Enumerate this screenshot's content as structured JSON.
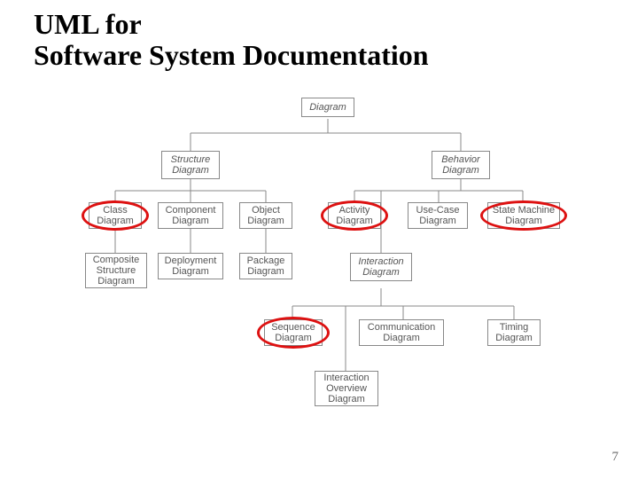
{
  "title_line1": "UML for",
  "title_line2": "Software System Documentation",
  "page_number": "7",
  "nodes": {
    "root": {
      "label": "Diagram"
    },
    "structure": {
      "label": "Structure\nDiagram"
    },
    "behavior": {
      "label": "Behavior\nDiagram"
    },
    "class": {
      "label": "Class\nDiagram"
    },
    "component": {
      "label": "Component\nDiagram"
    },
    "object": {
      "label": "Object\nDiagram"
    },
    "activity": {
      "label": "Activity\nDiagram"
    },
    "usecase": {
      "label": "Use-Case\nDiagram"
    },
    "statemachine": {
      "label": "State Machine\nDiagram"
    },
    "composite": {
      "label": "Composite\nStructure\nDiagram"
    },
    "deployment": {
      "label": "Deployment\nDiagram"
    },
    "package": {
      "label": "Package\nDiagram"
    },
    "interaction": {
      "label": "Interaction\nDiagram"
    },
    "sequence": {
      "label": "Sequence\nDiagram"
    },
    "communication": {
      "label": "Communication\nDiagram"
    },
    "timing": {
      "label": "Timing\nDiagram"
    },
    "ioverview": {
      "label": "Interaction\nOverview\nDiagram"
    }
  },
  "highlighted": [
    "class",
    "activity",
    "statemachine",
    "sequence"
  ],
  "hierarchy": {
    "Diagram": {
      "Structure Diagram": [
        "Class Diagram",
        "Component Diagram",
        "Object Diagram",
        "Composite Structure Diagram",
        "Deployment Diagram",
        "Package Diagram"
      ],
      "Behavior Diagram": {
        "Activity Diagram": [],
        "Use-Case Diagram": [],
        "State Machine Diagram": [],
        "Interaction Diagram": [
          "Sequence Diagram",
          "Communication Diagram",
          "Timing Diagram",
          "Interaction Overview Diagram"
        ]
      }
    }
  }
}
